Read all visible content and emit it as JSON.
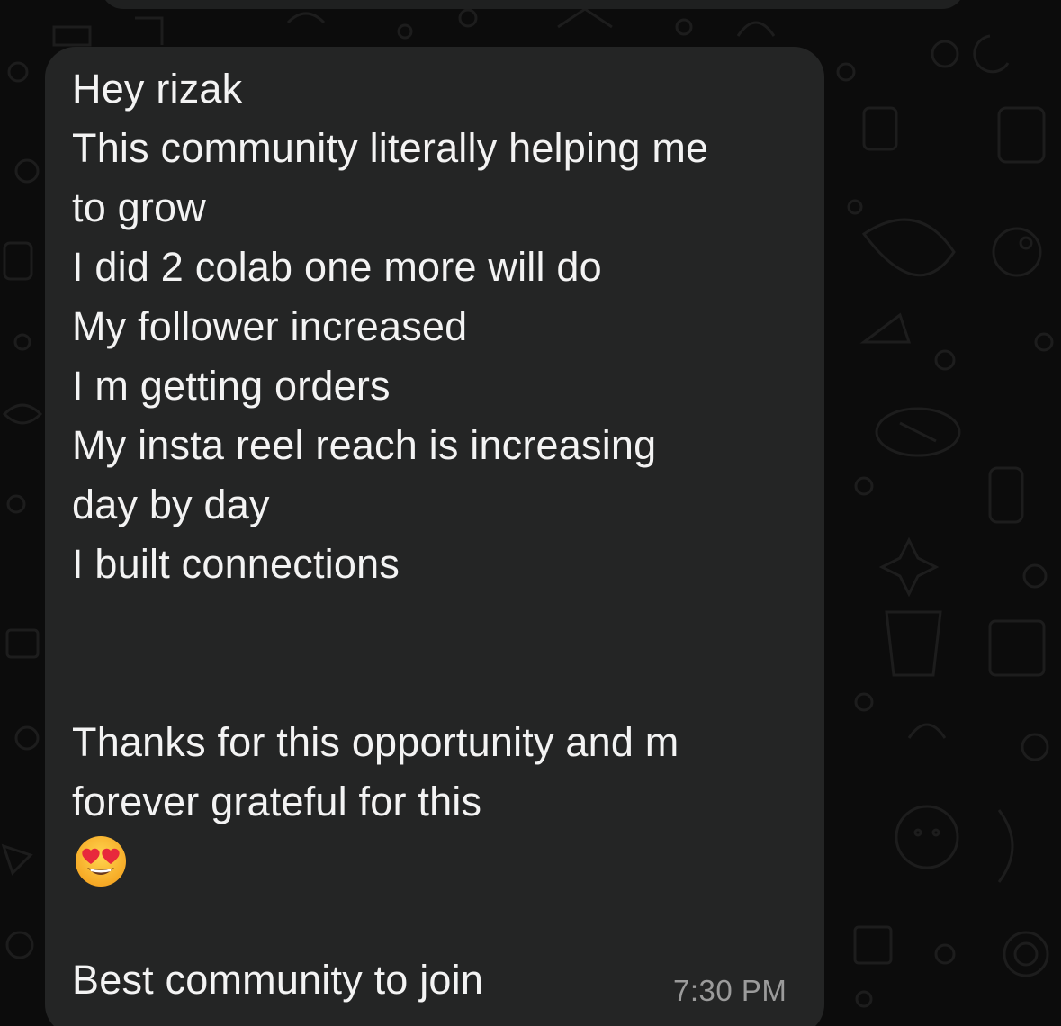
{
  "chat": {
    "message": {
      "lines": [
        "Hey rizak",
        "This community literally helping me",
        "to grow",
        "I did 2 colab one more will do",
        "My follower increased",
        "I m getting orders",
        "My insta reel reach is increasing",
        "day by day",
        "I built connections",
        "",
        "",
        "Thanks for this opportunity and m",
        "forever grateful for this",
        "😍",
        "",
        "Best community to join"
      ],
      "emoji_icon": "heart-eyes-emoji",
      "timestamp": "7:30 PM"
    },
    "colors": {
      "bubble": "#242525",
      "text": "#f3f3f3",
      "timestamp": "#9b9b9b",
      "background": "#0c0c0c"
    }
  }
}
